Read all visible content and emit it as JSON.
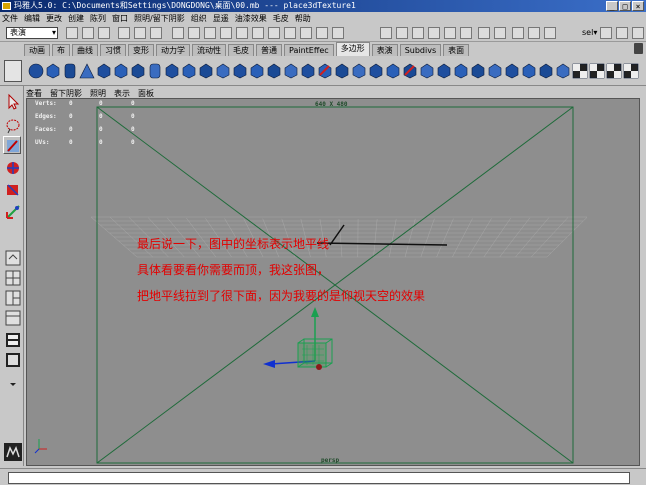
{
  "window": {
    "title": "玛雅人5.0: C:\\Documents和Settings\\DONGDONG\\桌面\\00.mb    ---    place3dTexture1",
    "buttons": [
      "_",
      "□",
      "×"
    ]
  },
  "menubar": {
    "items": [
      "文件",
      "编辑",
      "更改",
      "创建",
      "陈列",
      "窗口",
      "照明/留下阴影",
      "组织",
      "显遥",
      "油漆效果",
      "毛皮",
      "帮助"
    ]
  },
  "statusline": {
    "mode_value": "表演",
    "select_label": "sel▾"
  },
  "shelf": {
    "tabs": [
      "动画",
      "布",
      "曲线",
      "习惯",
      "变形",
      "动力学",
      "流动性",
      "毛皮",
      "普通",
      "PaintEffec",
      "多边形",
      "表演",
      "Subdivs",
      "表面"
    ],
    "active_tab": "多边形",
    "icon_count": 36
  },
  "panel": {
    "menu": [
      "查看",
      "留下阴影",
      "照明",
      "表示",
      "面板"
    ]
  },
  "viewport": {
    "resolution_label": "640 X 480",
    "camera_label": "persp",
    "hud": [
      {
        "label": "Verts:",
        "v1": "0",
        "v2": "0",
        "v3": "0"
      },
      {
        "label": "Edges:",
        "v1": "0",
        "v2": "0",
        "v3": "0"
      },
      {
        "label": "Faces:",
        "v1": "0",
        "v2": "0",
        "v3": "0"
      },
      {
        "label": "UVs:",
        "v1": "0",
        "v2": "0",
        "v3": "0"
      }
    ],
    "annotation": [
      "最后说一下，图中的坐标表示地平线",
      "具体看要看你需要而顶，我这张图，",
      "把地平线拉到了很下面，因为我要的是仰视天空的效果"
    ],
    "annotation_color": "#e30000"
  },
  "colors": {
    "titlebar": "#0a2a6e",
    "viewport_bg": "#8e8e8e",
    "frame_line": "#1f6b3a",
    "manip_green": "#1aa050",
    "manip_blue": "#1030d0"
  }
}
